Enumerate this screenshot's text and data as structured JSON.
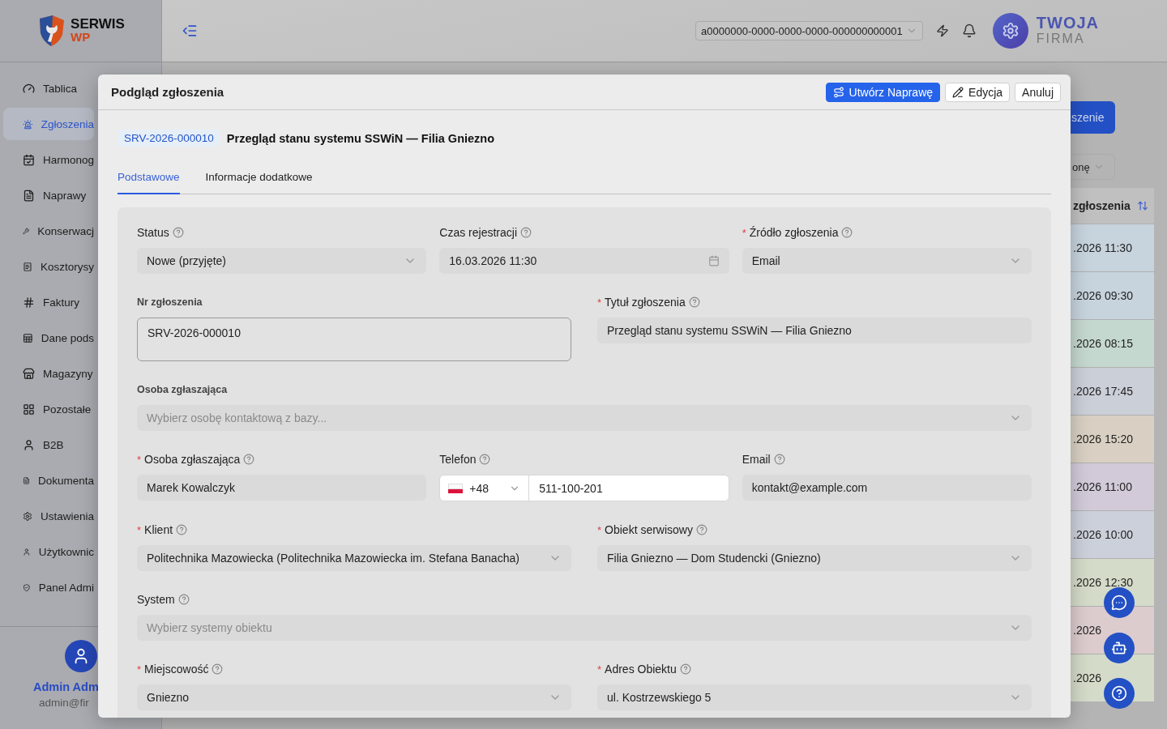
{
  "header": {
    "logo": {
      "line1": "SERWIS",
      "line2": "WP"
    },
    "tenant_select": {
      "value": "a0000000-0000-0000-0000-000000000001"
    },
    "company": {
      "line1": "TWOJA",
      "line2": "FIRMA"
    }
  },
  "sidebar": {
    "items": [
      {
        "label": "Tablica",
        "selected": false
      },
      {
        "label": "Zgłoszenia",
        "selected": true
      },
      {
        "label": "Harmonog",
        "selected": false
      },
      {
        "label": "Naprawy",
        "selected": false
      },
      {
        "label": "Konserwacj",
        "selected": false
      },
      {
        "label": "Kosztorysy",
        "selected": false
      },
      {
        "label": "Faktury",
        "selected": false
      },
      {
        "label": "Dane pods",
        "selected": false
      },
      {
        "label": "Magazyny",
        "selected": false
      },
      {
        "label": "Pozostałe",
        "selected": false
      },
      {
        "label": "B2B",
        "selected": false
      },
      {
        "label": "Dokumenta",
        "selected": false
      },
      {
        "label": "Ustawienia",
        "selected": false
      },
      {
        "label": "Użytkownic",
        "selected": false
      },
      {
        "label": "Panel Admi",
        "selected": false
      }
    ],
    "user": {
      "name": "Admin Adm",
      "email": "admin@fir"
    }
  },
  "background": {
    "new_button": "szenie",
    "filter_select": "onę",
    "column": "zgłoszenia",
    "rows": [
      {
        "time": ".2026 11:30",
        "color": "#c7d3dd"
      },
      {
        "time": ".2026 09:30",
        "color": "#c7d3dd"
      },
      {
        "time": ".2026 08:15",
        "color": "#c5d8d0"
      },
      {
        "time": ".2026 17:45",
        "color": "#cbcfd8"
      },
      {
        "time": ".2026 15:20",
        "color": "#d9d0c3"
      },
      {
        "time": ".2026 11:00",
        "color": "#d2cad9"
      },
      {
        "time": ".2026 10:00",
        "color": "#ccd0da"
      },
      {
        "time": ".2026 12:30",
        "color": "#d4dbc9"
      },
      {
        "time": ".2026",
        "color": "#dccccd"
      },
      {
        "time": ".2026",
        "color": "#d4dbc9"
      }
    ]
  },
  "modal": {
    "title": "Podgląd zgłoszenia",
    "buttons": [
      {
        "label": "Utwórz Naprawę",
        "kind": "primary"
      },
      {
        "label": "Edycja",
        "kind": "edit"
      },
      {
        "label": "Anuluj",
        "kind": "plain"
      }
    ],
    "ticket_tag": "SRV-2026-000010",
    "ticket_title": "Przegląd stanu systemu SSWiN — Filia Gniezno",
    "tabs": [
      {
        "label": "Podstawowe",
        "selected": true
      },
      {
        "label": "Informacje dodatkowe",
        "selected": false
      }
    ],
    "form_rows": [
      {
        "fields": [
          {
            "label": "Status",
            "bold_label": false,
            "help": true,
            "kind": "select",
            "value": "Nowe (przyjęte)"
          },
          {
            "label": "Czas rejestracji",
            "bold_label": false,
            "help": true,
            "kind": "date",
            "value": "16.03.2026 11:30"
          },
          {
            "required_mark": "*",
            "label": "Źródło zgłoszenia",
            "bold_label": false,
            "help": true,
            "kind": "select",
            "value": "Email"
          }
        ]
      },
      {
        "fields": [
          {
            "label": "Nr zgłoszenia",
            "bold_label": true,
            "help": false,
            "kind": "textarea",
            "value": "SRV-2026-000010"
          },
          {
            "required_mark": "*",
            "label": "Tytuł zgłoszenia",
            "bold_label": false,
            "help": true,
            "kind": "input",
            "value": "Przegląd stanu systemu SSWiN — Filia Gniezno"
          }
        ]
      },
      {
        "fields": [
          {
            "label": "Osoba zgłaszająca",
            "bold_label": true,
            "help": false,
            "kind": "select",
            "placeholder": "Wybierz osobę kontaktową z bazy..."
          }
        ]
      },
      {
        "fields": [
          {
            "required_mark": "*",
            "label": "Osoba zgłaszająca",
            "bold_label": false,
            "help": true,
            "kind": "input",
            "value": "Marek Kowalczyk"
          },
          {
            "label": "Telefon",
            "bold_label": false,
            "help": true,
            "kind": "phone",
            "prefix": "+48",
            "value": "511-100-201"
          },
          {
            "label": "Email",
            "bold_label": false,
            "help": true,
            "kind": "input",
            "value": "kontakt@example.com"
          }
        ]
      },
      {
        "fields": [
          {
            "required_mark": "*",
            "label": "Klient",
            "bold_label": false,
            "help": true,
            "kind": "select",
            "value": "Politechnika Mazowiecka (Politechnika Mazowiecka im. Stefana Banacha)"
          },
          {
            "required_mark": "*",
            "label": "Obiekt serwisowy",
            "bold_label": false,
            "help": true,
            "kind": "select",
            "value": "Filia Gniezno — Dom Studencki (Gniezno)"
          }
        ]
      },
      {
        "fields": [
          {
            "label": "System",
            "bold_label": false,
            "help": true,
            "kind": "select",
            "placeholder": "Wybierz systemy obiektu"
          }
        ]
      },
      {
        "fields": [
          {
            "required_mark": "*",
            "label": "Miejscowość",
            "bold_label": false,
            "help": true,
            "kind": "select",
            "value": "Gniezno"
          },
          {
            "required_mark": "*",
            "label": "Adres Obiektu",
            "bold_label": false,
            "help": true,
            "kind": "select",
            "value": "ul. Kostrzewskiego 5"
          }
        ]
      }
    ]
  }
}
